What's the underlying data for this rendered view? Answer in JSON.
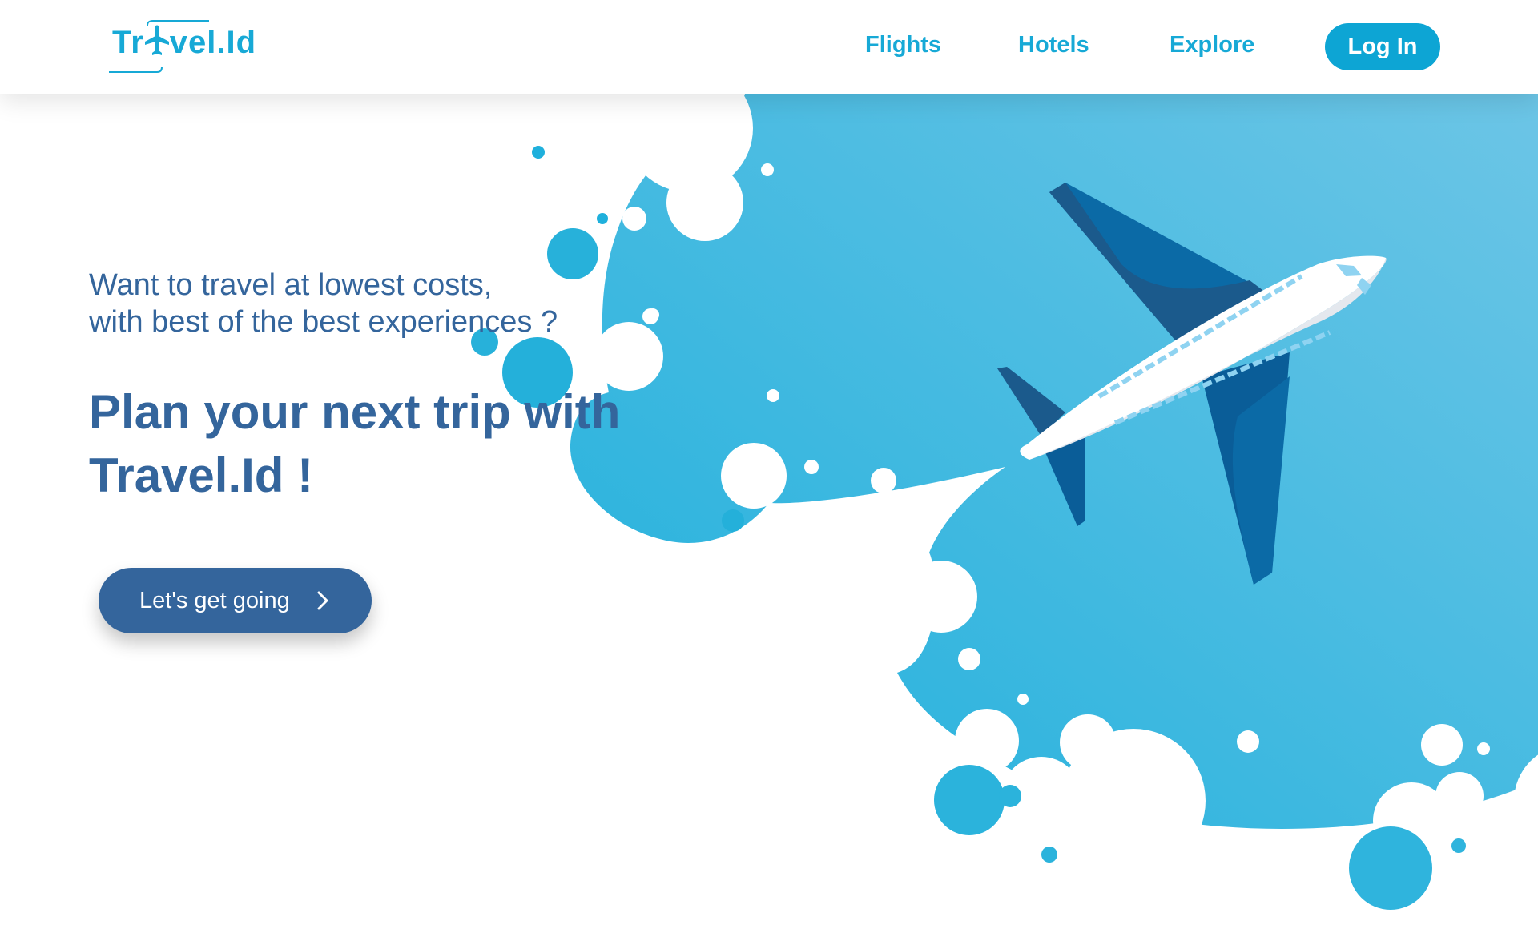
{
  "header": {
    "logo": {
      "text_before": "Tr",
      "text_after": "vel.Id"
    },
    "nav": {
      "flights": "Flights",
      "hotels": "Hotels",
      "explore": "Explore"
    },
    "login_label": "Log In"
  },
  "hero": {
    "tagline_line1": "Want to travel at lowest costs,",
    "tagline_line2": "with best of the best experiences ?",
    "headline_line1": "Plan your next trip with",
    "headline_line2": "Travel.Id !",
    "cta_label": "Let's get going",
    "cta_icon": "chevron-right-icon"
  },
  "colors": {
    "brand_blue": "#17a9d6",
    "login_bg": "#0da5d4",
    "heading_navy": "#34659c",
    "sky_light": "#5dc1e3",
    "sky_deep": "#1fb0dc",
    "plane_dark": "#1a5a8e",
    "plane_body": "#ffffff",
    "window": "#8fd3f1"
  }
}
